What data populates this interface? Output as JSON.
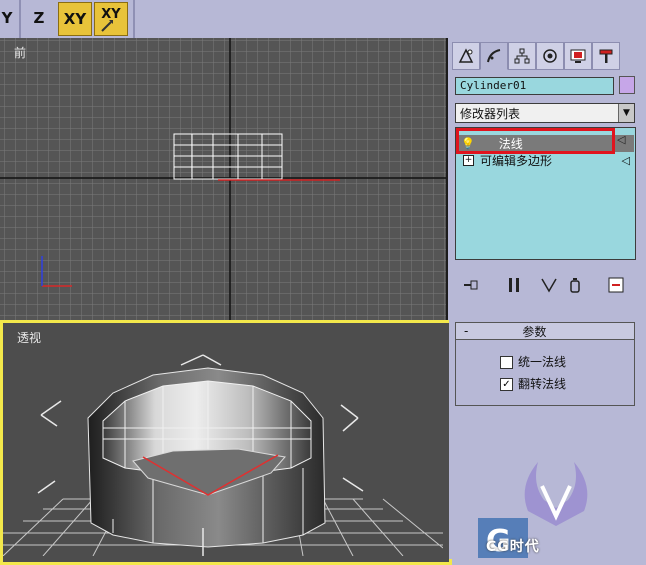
{
  "toolbar": {
    "buttons": [
      {
        "label": "Y",
        "active": false
      },
      {
        "label": "Z",
        "active": false
      },
      {
        "label": "XY",
        "active": true
      },
      {
        "label": "XY",
        "active": true
      }
    ]
  },
  "viewports": {
    "front": {
      "label": "前"
    },
    "perspective": {
      "label": "透视"
    }
  },
  "command_panel": {
    "tabs": [
      "create-icon",
      "modify-icon",
      "hierarchy-icon",
      "motion-icon",
      "display-icon",
      "utilities-icon"
    ],
    "object_name": "Cylinder01",
    "object_color": "#c6a6e8",
    "modifier_list_label": "修改器列表",
    "stack": [
      {
        "label": "法线",
        "selected": true
      },
      {
        "label": "可编辑多边形",
        "selected": false
      }
    ],
    "highlight_color": "#e0141e",
    "stack_tools": [
      "pin-stack-icon",
      "show-end-result-icon",
      "make-unique-icon",
      "remove-modifier-icon",
      "configure-sets-icon"
    ],
    "rollout": {
      "title": "参数",
      "toggle": "-",
      "options": [
        {
          "label": "统一法线",
          "checked": false
        },
        {
          "label": "翻转法线",
          "checked": true
        }
      ]
    }
  },
  "watermark": {
    "text": "CG时代"
  }
}
